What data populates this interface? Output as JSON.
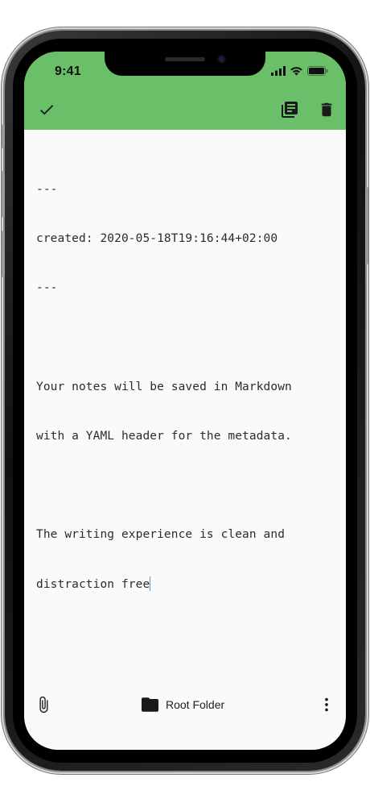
{
  "status_bar": {
    "time": "9:41",
    "icons": [
      "cellular-signal-icon",
      "wifi-icon",
      "battery-icon"
    ]
  },
  "app_bar": {
    "color": "#6abf69",
    "actions": {
      "left": "checkmark-icon",
      "right": [
        "library-books-icon",
        "delete-icon"
      ]
    }
  },
  "editor": {
    "lines": [
      "---",
      "created: 2020-05-18T19:16:44+02:00",
      "---",
      "",
      "Your notes will be saved in Markdown",
      "with a YAML header for the metadata.",
      "",
      "The writing experience is clean and",
      "distraction free"
    ]
  },
  "bottom_bar": {
    "attach_icon": "paperclip-icon",
    "folder_icon": "folder-icon",
    "folder_label": "Root Folder",
    "more_icon": "more-vert-icon"
  }
}
